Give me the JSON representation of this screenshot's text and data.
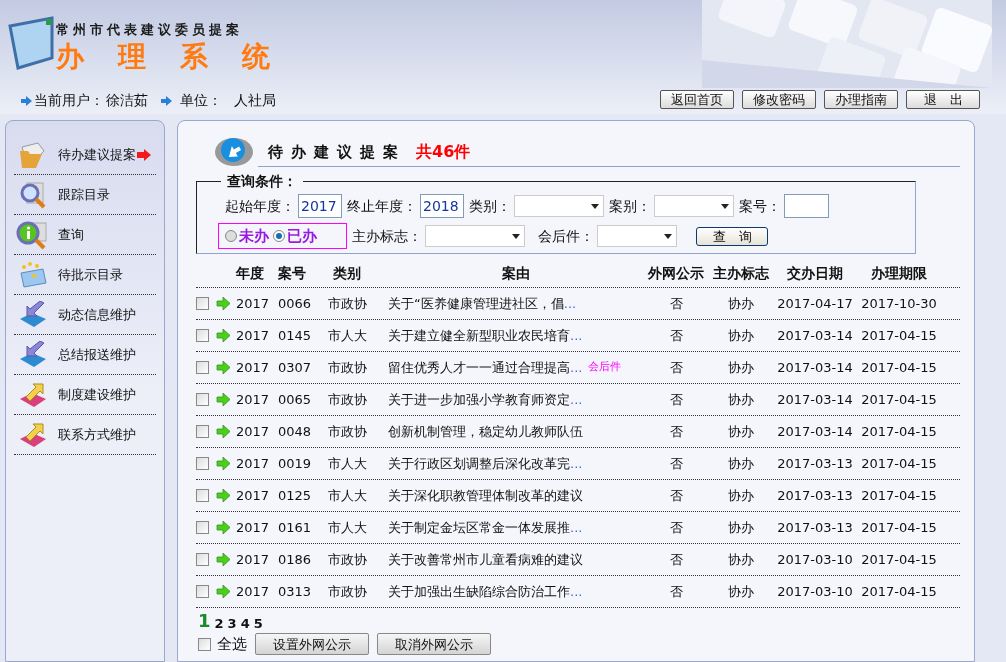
{
  "header": {
    "subtitle": "常州市代表建议委员提案",
    "title": "办理系统"
  },
  "userbar": {
    "user_label": "当前用户：",
    "user": "徐洁茹",
    "unit_label": "单位：",
    "unit": "人社局"
  },
  "top_buttons": [
    "返回首页",
    "修改密码",
    "办理指南",
    "退　出"
  ],
  "sidebar": {
    "items": [
      {
        "label": "待办建议提案",
        "kind": "folder",
        "selected": true
      },
      {
        "label": "跟踪目录",
        "kind": "magnifier",
        "selected": false
      },
      {
        "label": "查询",
        "kind": "info",
        "selected": false
      },
      {
        "label": "待批示目录",
        "kind": "mail",
        "selected": false
      },
      {
        "label": "动态信息维护",
        "kind": "down",
        "selected": false
      },
      {
        "label": "总结报送维护",
        "kind": "down",
        "selected": false
      },
      {
        "label": "制度建设维护",
        "kind": "up",
        "selected": false
      },
      {
        "label": "联系方式维护",
        "kind": "up",
        "selected": false
      }
    ]
  },
  "panel": {
    "title": "待办建议提案",
    "count": "共46件"
  },
  "query": {
    "legend": "查询条件：",
    "start_label": "起始年度：",
    "start": "2017",
    "end_label": "终止年度：",
    "end": "2018",
    "category_label": "类别：",
    "case_label": "案别：",
    "number_label": "案号：",
    "status": [
      {
        "label": "未办",
        "selected": false
      },
      {
        "label": "已办",
        "selected": true
      }
    ],
    "lead_label": "主办标志：",
    "after_label": "会后件：",
    "button": "查　询"
  },
  "table": {
    "columns": [
      "年度",
      "案号",
      "类别",
      "案由",
      "外网公示",
      "主办标志",
      "交办日期",
      "办理期限"
    ],
    "rows": [
      {
        "checked": false,
        "year": "2017",
        "no": "0066",
        "category": "市政协",
        "title": "关于“医养健康管理进社区，倡",
        "more": "...",
        "public": "否",
        "lead": "协办",
        "assigned": "2017-04-17",
        "deadline": "2017-10-30"
      },
      {
        "checked": false,
        "year": "2017",
        "no": "0145",
        "category": "市人大",
        "title": "关于建立健全新型职业农民培育",
        "more": "...",
        "public": "否",
        "lead": "协办",
        "assigned": "2017-03-14",
        "deadline": "2017-04-15"
      },
      {
        "checked": false,
        "year": "2017",
        "no": "0307",
        "category": "市政协",
        "title": "留住优秀人才一一通过合理提高",
        "more": "...",
        "tag": "会后件",
        "public": "否",
        "lead": "协办",
        "assigned": "2017-03-14",
        "deadline": "2017-04-15"
      },
      {
        "checked": false,
        "year": "2017",
        "no": "0065",
        "category": "市政协",
        "title": "关于进一步加强小学教育师资定",
        "more": "...",
        "public": "否",
        "lead": "协办",
        "assigned": "2017-03-14",
        "deadline": "2017-04-15"
      },
      {
        "checked": false,
        "year": "2017",
        "no": "0048",
        "category": "市政协",
        "title": "创新机制管理，稳定幼儿教师队伍",
        "public": "否",
        "lead": "协办",
        "assigned": "2017-03-14",
        "deadline": "2017-04-15"
      },
      {
        "checked": false,
        "year": "2017",
        "no": "0019",
        "category": "市人大",
        "title": "关于行政区划调整后深化改革完",
        "more": "...",
        "public": "否",
        "lead": "协办",
        "assigned": "2017-03-13",
        "deadline": "2017-04-15"
      },
      {
        "checked": false,
        "year": "2017",
        "no": "0125",
        "category": "市人大",
        "title": "关于深化职教管理体制改革的建议",
        "public": "否",
        "lead": "协办",
        "assigned": "2017-03-13",
        "deadline": "2017-04-15"
      },
      {
        "checked": false,
        "year": "2017",
        "no": "0161",
        "category": "市人大",
        "title": "关于制定金坛区常金一体发展推",
        "more": "...",
        "public": "否",
        "lead": "协办",
        "assigned": "2017-03-13",
        "deadline": "2017-04-15"
      },
      {
        "checked": false,
        "year": "2017",
        "no": "0186",
        "category": "市政协",
        "title": "关于改善常州市儿童看病难的建议",
        "public": "否",
        "lead": "协办",
        "assigned": "2017-03-10",
        "deadline": "2017-04-15"
      },
      {
        "checked": false,
        "year": "2017",
        "no": "0313",
        "category": "市政协",
        "title": "关于加强出生缺陷综合防治工作",
        "more": "...",
        "public": "否",
        "lead": "协办",
        "assigned": "2017-03-10",
        "deadline": "2017-04-15"
      }
    ]
  },
  "pagination": [
    {
      "label": "1",
      "selected": true
    },
    {
      "label": "2",
      "selected": false
    },
    {
      "label": "3",
      "selected": false
    },
    {
      "label": "4",
      "selected": false
    },
    {
      "label": "5",
      "selected": false
    }
  ],
  "footer": {
    "select_all": {
      "label": "全选",
      "checked": false
    },
    "buttons": [
      "设置外网公示",
      "取消外网公示"
    ]
  }
}
